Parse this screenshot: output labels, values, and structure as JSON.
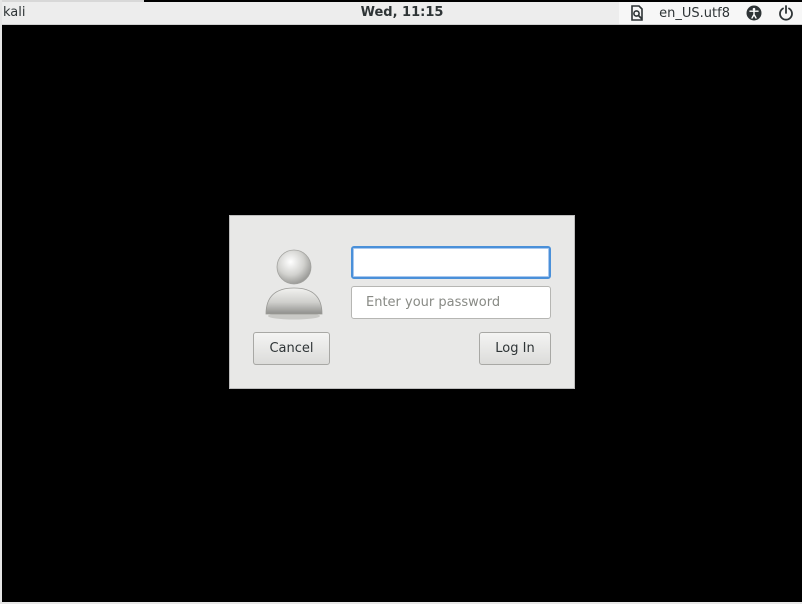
{
  "panel": {
    "hostname": "kali",
    "clock": "Wed, 11:15",
    "keyboard_layout": "en_US.utf8",
    "icons": [
      "keyboard-indicator-icon",
      "accessibility-icon",
      "power-icon"
    ]
  },
  "login": {
    "username_value": "",
    "password_placeholder": "Enter your password",
    "cancel_label": "Cancel",
    "login_label": "Log In",
    "avatar_icon": "user-avatar-icon"
  },
  "colors": {
    "background": "#000000",
    "panel": "#ededed",
    "dialog": "#e8e8e7",
    "focus": "#4a90d9"
  }
}
